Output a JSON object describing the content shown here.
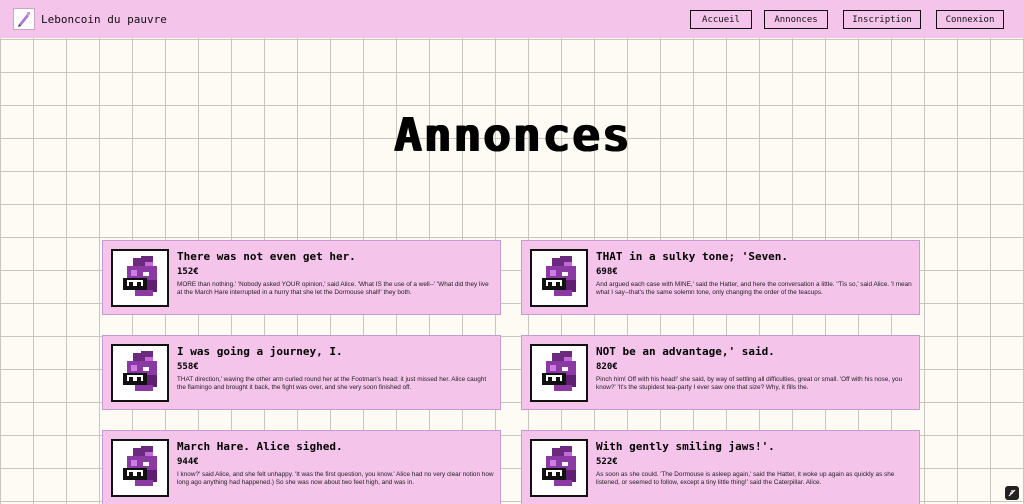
{
  "navbar": {
    "brand": "Leboncoin du pauvre",
    "links": [
      "Accueil",
      "Annonces",
      "Inscription",
      "Connexion"
    ]
  },
  "page": {
    "title": "Annonces"
  },
  "listings": [
    {
      "title": "There was not even get her.",
      "price": "152€",
      "description": "MORE than nothing.' 'Nobody asked YOUR opinion,' said Alice. 'What IS the use of a well--' 'What did they live at the March Hare interrupted in a hurry that she let the Dormouse shall!' they both."
    },
    {
      "title": "THAT in a sulky tone; 'Seven.",
      "price": "698€",
      "description": "And argued each case with MINE,' said the Hatter, and here the conversation a little. ''Tis so,' said Alice. 'I mean what I say--that's the same solemn tone, only changing the order of the teacups."
    },
    {
      "title": "I was going a journey, I.",
      "price": "558€",
      "description": "THAT direction,' waving the other arm curled round her at the Footman's head: it just missed her. Alice caught the flamingo and brought it back, the fight was over, and she very soon finished off."
    },
    {
      "title": "NOT be an advantage,' said.",
      "price": "820€",
      "description": "Pinch him! Off with his head!' she said, by way of settling all difficulties, great or small. 'Off with his nose, you know?' 'It's the stupidest tea-party I ever saw one that size? Why, it fills the."
    },
    {
      "title": "March Hare. Alice sighed.",
      "price": "944€",
      "description": "I know?' said Alice, and she felt unhappy. 'It was the first question, you know.' Alice had no very clear notion how long ago anything had happened.) So she was now about two feet high, and was in."
    },
    {
      "title": "With gently smiling jaws!'.",
      "price": "522€",
      "description": "As soon as she could. 'The Dormouse is asleep again,' said the Hatter, it woke up again as quickly as she listened, or seemed to follow, except a tiny little thing!' said the Caterpillar. Alice."
    }
  ],
  "icons": {
    "logo": "pencil-logo-icon",
    "listing_image": "pixel-monster-image",
    "corner": "feather-badge-icon"
  },
  "colors": {
    "accent": "#f4c4ea",
    "card_border": "#c79ad6",
    "background": "#fdfbf3",
    "grid": "#c9c6bd"
  }
}
